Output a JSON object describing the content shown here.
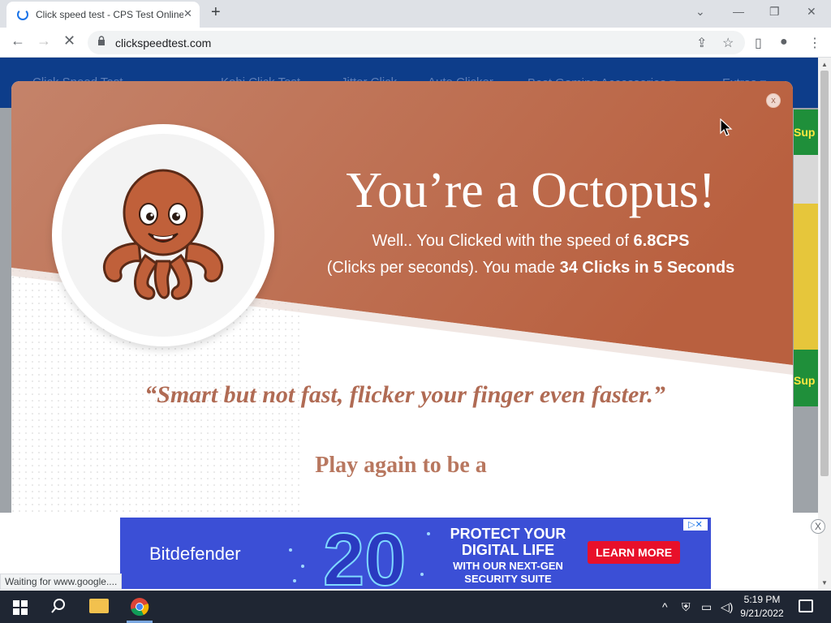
{
  "browser": {
    "tab_title": "Click speed test - CPS Test Online",
    "tab_close": "✕",
    "new_tab": "+",
    "window_controls": {
      "minimize": "—",
      "restore": "❐",
      "close": "✕",
      "tabsearch": "⌄"
    },
    "nav": {
      "back": "←",
      "forward": "→",
      "stop": "✕"
    },
    "url": "clickspeedtest.com",
    "toolbar_icons": {
      "share": "⇪",
      "bookmark": "☆",
      "sidepanel": "▯",
      "profile": "●",
      "menu": "⋮"
    }
  },
  "site_nav": {
    "links": [
      "Click Speed Test",
      "Kohi Click Test",
      "Jitter Click",
      "Auto Clicker",
      "Best Gaming Accessories ▾",
      "Extras ▾"
    ]
  },
  "side_ad": {
    "text1": "Sup",
    "text2": "Sup"
  },
  "modal": {
    "close_label": "x",
    "headline": "You’re a Octopus!",
    "speed_prefix": "Well.. You Clicked with the speed of ",
    "speed_value": "6.8CPS",
    "clicks_prefix": "(Clicks per seconds). You made ",
    "clicks_value": "34 Clicks in 5 Seconds",
    "quote": "“Smart but not fast, flicker your finger even faster.”",
    "play_again": "Play again to be a"
  },
  "ad": {
    "brand": "Bitdefender",
    "number": "20",
    "headline": "PROTECT YOUR DIGITAL LIFE",
    "subline": "WITH OUR NEXT-GEN SECURITY SUITE",
    "cta": "LEARN MORE",
    "close": "X"
  },
  "status_text": "Waiting for www.google....",
  "taskbar": {
    "time": "5:19 PM",
    "date": "9/21/2022",
    "tray_chevron": "^"
  },
  "colors": {
    "modal_accent": "#b86a4f",
    "site_nav": "#0d3d8a"
  }
}
